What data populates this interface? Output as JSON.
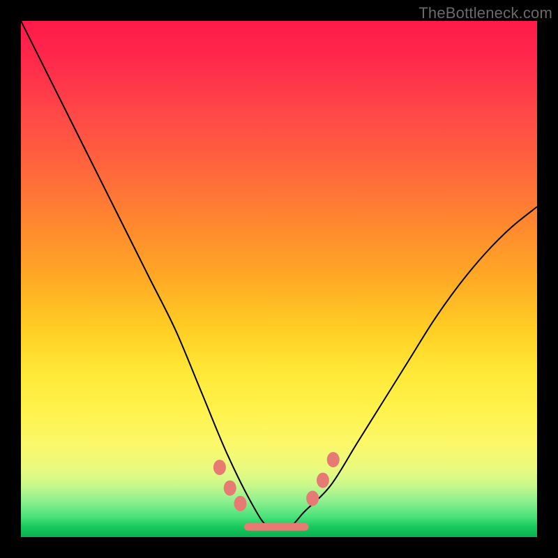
{
  "watermark": "TheBottleneck.com",
  "colors": {
    "gradient_top": "#ff1a4a",
    "gradient_bottom": "#0ab050",
    "curve": "#000000",
    "markers": "#e77b74",
    "frame": "#000000"
  },
  "chart_data": {
    "type": "line",
    "title": "",
    "xlabel": "",
    "ylabel": "",
    "xlim": [
      0,
      100
    ],
    "ylim": [
      0,
      100
    ],
    "grid": false,
    "legend": false,
    "series": [
      {
        "name": "bottleneck-curve",
        "x": [
          0,
          5,
          10,
          15,
          20,
          25,
          30,
          35,
          40,
          45,
          48,
          52,
          55,
          60,
          65,
          70,
          75,
          80,
          85,
          90,
          95,
          100
        ],
        "y": [
          100,
          90,
          80,
          70,
          60,
          50,
          40,
          28,
          16,
          6,
          2,
          2,
          5,
          10,
          18,
          26,
          34,
          42,
          49,
          55,
          60,
          64
        ]
      }
    ],
    "markers": {
      "name": "valley-emphasis-beads",
      "x": [
        38.5,
        40.5,
        42.5,
        56.5,
        58.5,
        60.5
      ],
      "y": [
        13.5,
        9.5,
        6.5,
        7.5,
        11.0,
        15.0
      ]
    },
    "flat_segment": {
      "name": "optimal-range",
      "x_start": 44,
      "x_end": 55,
      "y": 2
    },
    "background_gradient": {
      "orientation": "vertical",
      "stops": [
        {
          "pos": 0,
          "color": "#ff1a4a"
        },
        {
          "pos": 50,
          "color": "#ffaa24"
        },
        {
          "pos": 80,
          "color": "#fbf86a"
        },
        {
          "pos": 100,
          "color": "#0ab050"
        }
      ]
    }
  }
}
